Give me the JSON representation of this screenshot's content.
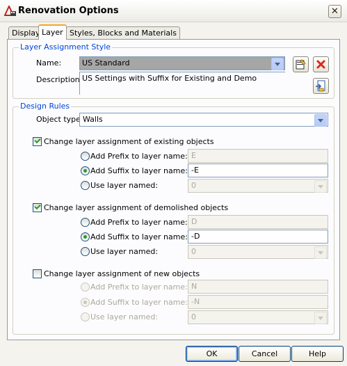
{
  "window": {
    "title": "Renovation Options"
  },
  "tabs": [
    {
      "label": "Display",
      "active": false
    },
    {
      "label": "Layer",
      "active": true
    },
    {
      "label": "Styles, Blocks and Materials",
      "active": false
    }
  ],
  "layer_assignment": {
    "legend": "Layer Assignment Style",
    "name_label": "Name:",
    "name_value": "US Standard",
    "description_label": "Description:",
    "description_value": "US Settings with Suffix for Existing and Demo",
    "buttons": [
      "edit-style-icon",
      "delete-style-icon",
      "import-style-icon"
    ]
  },
  "design_rules": {
    "legend": "Design Rules",
    "object_type_label": "Object type:",
    "object_type_value": "Walls",
    "existing": {
      "checkbox_label": "Change layer assignment of existing objects",
      "checked": true,
      "prefix_label": "Add Prefix to layer name:",
      "prefix_value": "E",
      "suffix_label": "Add Suffix to layer name:",
      "suffix_value": "-E",
      "named_label": "Use layer named:",
      "named_value": "0",
      "selected": "suffix"
    },
    "demolished": {
      "checkbox_label": "Change layer assignment of demolished objects",
      "checked": true,
      "prefix_label": "Add Prefix to layer name:",
      "prefix_value": "D",
      "suffix_label": "Add Suffix to layer name:",
      "suffix_value": "-D",
      "named_label": "Use layer named:",
      "named_value": "0",
      "selected": "suffix"
    },
    "new": {
      "checkbox_label": "Change layer assignment of new objects",
      "checked": false,
      "prefix_label": "Add Prefix to layer name:",
      "prefix_value": "N",
      "suffix_label": "Add Suffix to layer name:",
      "suffix_value": "-N",
      "named_label": "Use layer named:",
      "named_value": "0",
      "selected": "suffix"
    }
  },
  "footer": {
    "ok": "OK",
    "cancel": "Cancel",
    "help": "Help"
  },
  "colors": {
    "legend": "#0046d5",
    "accent_tab": "#f5a622",
    "check": "#21a121",
    "delete": "#e0261b"
  }
}
